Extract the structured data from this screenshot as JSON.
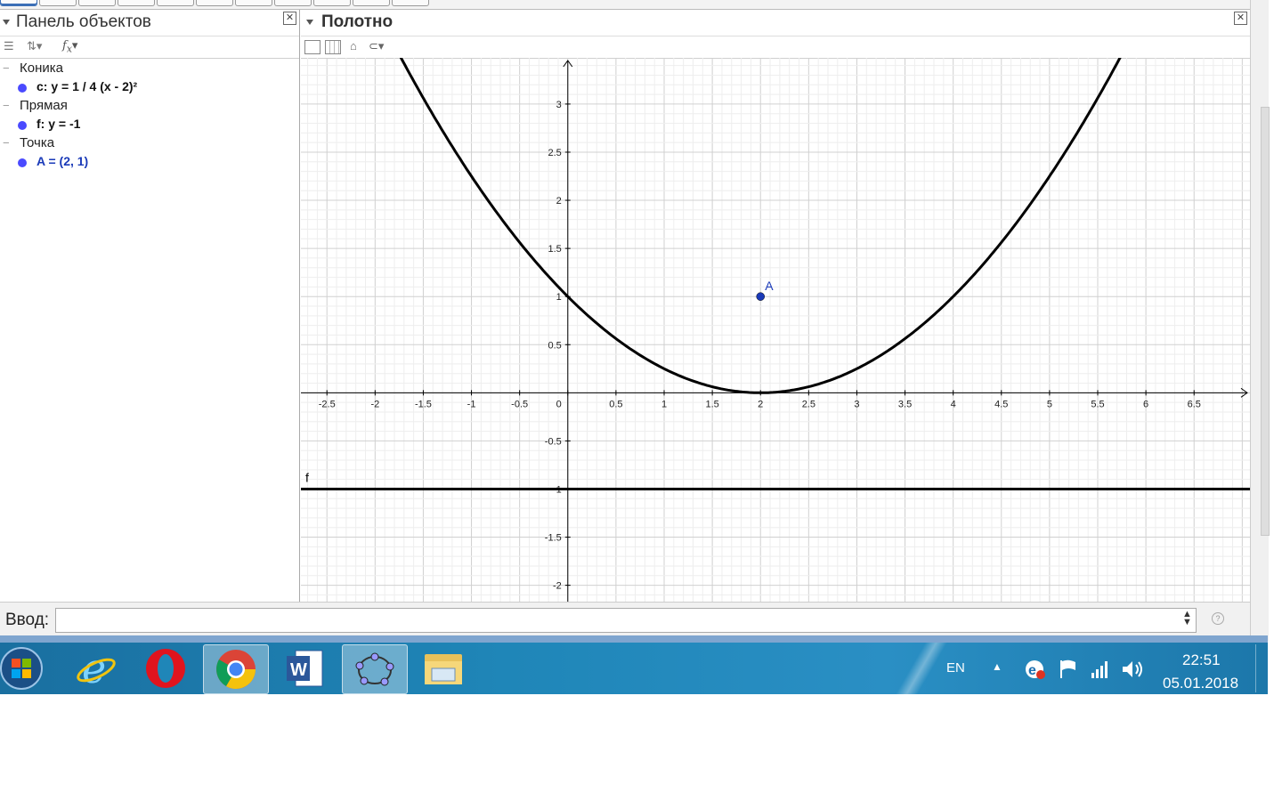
{
  "object_panel": {
    "title": "Панель объектов",
    "groups": [
      {
        "category": "Коника",
        "item": "c: y = 1 / 4 (x - 2)²"
      },
      {
        "category": "Прямая",
        "item": "f: y = -1"
      },
      {
        "category": "Точка",
        "item": "A = (2, 1)"
      }
    ]
  },
  "canvas_panel": {
    "title": "Полотно"
  },
  "graph": {
    "x_ticks": [
      "-2.5",
      "-2",
      "-1.5",
      "-1",
      "-0.5",
      "0",
      "0.5",
      "1",
      "1.5",
      "2",
      "2.5",
      "3",
      "3.5",
      "4",
      "4.5",
      "5",
      "5.5",
      "6",
      "6.5"
    ],
    "y_ticks": [
      "3",
      "2.5",
      "2",
      "1.5",
      "1",
      "0.5",
      "-0.5",
      "-1",
      "-1.5",
      "-2"
    ],
    "line_label": "f",
    "point_label": "A"
  },
  "chart_data": {
    "type": "line",
    "xlim": [
      -2.77,
      7.08
    ],
    "ylim": [
      -2.17,
      3.48
    ],
    "grid": true,
    "parabola": {
      "a": 0.25,
      "h": 2,
      "k": 0
    },
    "line": {
      "name": "f",
      "y": -1
    },
    "point": {
      "name": "A",
      "x": 2,
      "y": 1
    }
  },
  "input_bar": {
    "label": "Ввод:",
    "value": ""
  },
  "taskbar": {
    "lang": "EN",
    "time": "22:51",
    "date": "05.01.2018"
  },
  "colors": {
    "curve": "#000000",
    "point": "#1a3ab8",
    "grid_minor": "#eeeeee",
    "grid_major": "#d0d0d0",
    "taskbar": "#1f86b8"
  }
}
